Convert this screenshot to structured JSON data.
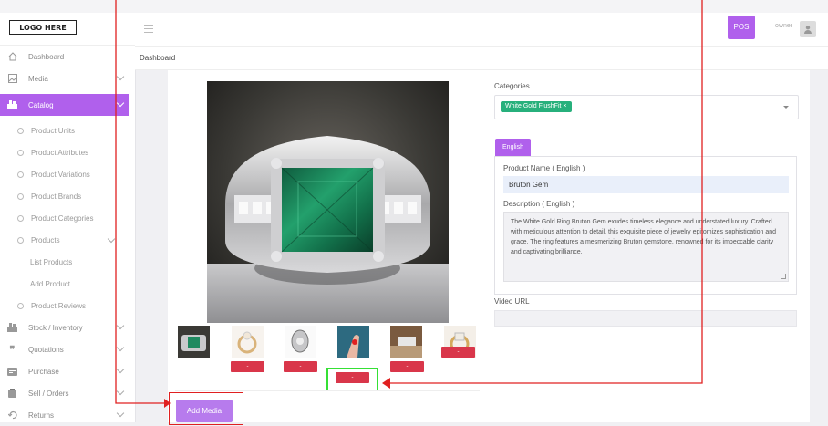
{
  "logo": "LOGO HERE",
  "sidebar": {
    "items": [
      {
        "label": "Dashboard",
        "icon": "home-icon"
      },
      {
        "label": "Media",
        "icon": "image-icon"
      },
      {
        "label": "Catalog",
        "icon": "catalog-icon"
      },
      {
        "label": "Stock / Inventory",
        "icon": "stock-icon"
      },
      {
        "label": "Quotations",
        "icon": "quote-icon"
      },
      {
        "label": "Purchase",
        "icon": "purchase-icon"
      },
      {
        "label": "Sell / Orders",
        "icon": "orders-icon"
      },
      {
        "label": "Returns",
        "icon": "returns-icon"
      }
    ],
    "catalog_sub": [
      "Product Units",
      "Product Attributes",
      "Product Variations",
      "Product Brands",
      "Product Categories",
      "Products"
    ],
    "products_sub": [
      "List Products",
      "Add Product"
    ],
    "reviews": "Product Reviews"
  },
  "header": {
    "pos_label": "POS",
    "user": "owner"
  },
  "breadcrumb": "Dashboard",
  "form": {
    "categories_label": "Categories",
    "category_chip": "White Gold FlushFit",
    "chip_remove": "×",
    "tab_english": "English",
    "product_name_label": "Product Name ( English )",
    "product_name_value": "Bruton Gem",
    "description_label": "Description ( English )",
    "description_value": "The White Gold Ring Bruton Gem exudes timeless elegance and understated luxury. Crafted with meticulous attention to detail, this exquisite piece of jewelry epitomizes sophistication and grace. The ring features a mesmerizing Bruton gemstone, renowned for its impeccable clarity and captivating brilliance.",
    "video_url_label": "Video URL"
  },
  "media": {
    "remove_label": "-",
    "add_media_label": "Add Media"
  },
  "colors": {
    "accent": "#b060ec",
    "emerald": "#1f8a60",
    "remove": "#d9364a",
    "chip": "#27b07c",
    "annotation_red": "#e02020",
    "annotation_green": "#35e035"
  }
}
